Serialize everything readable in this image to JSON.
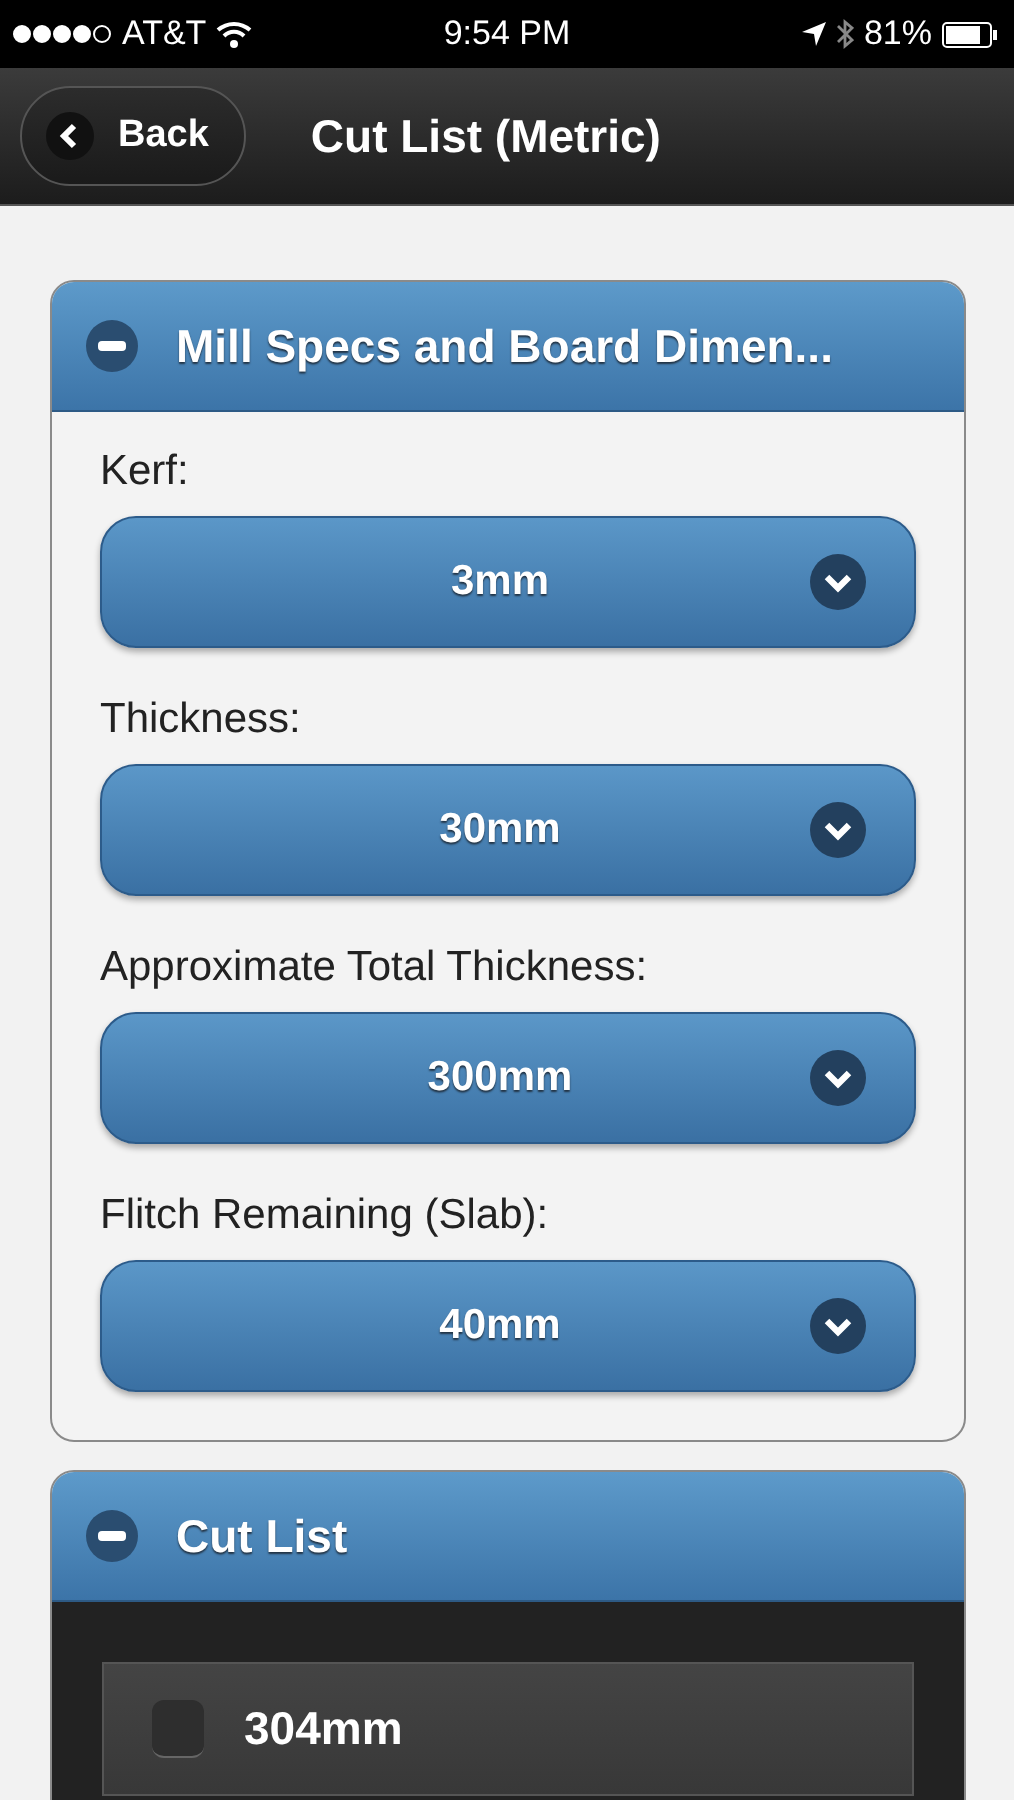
{
  "status_bar": {
    "carrier": "AT&T",
    "time": "9:54 PM",
    "battery": "81%"
  },
  "nav": {
    "back": "Back",
    "title": "Cut List (Metric)"
  },
  "sections": [
    {
      "title": "Mill Specs and Board Dimen...",
      "expanded": true,
      "kind": "form",
      "fields": [
        {
          "label": "Kerf:",
          "value": "3mm"
        },
        {
          "label": "Thickness:",
          "value": "30mm"
        },
        {
          "label": "Approximate Total Thickness:",
          "value": "300mm"
        },
        {
          "label": "Flitch Remaining (Slab):",
          "value": "40mm"
        }
      ]
    },
    {
      "title": "Cut List",
      "expanded": true,
      "kind": "list",
      "items": [
        {
          "label": "304mm",
          "checked": false
        }
      ]
    }
  ]
}
